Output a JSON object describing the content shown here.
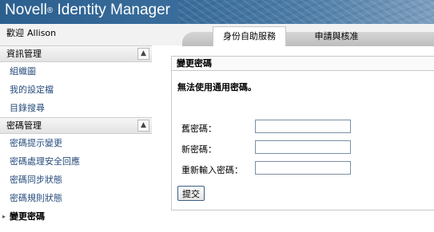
{
  "header": {
    "brand_name": "Novell",
    "brand_mark": "®",
    "product": "Identity Manager"
  },
  "welcome": {
    "label": "歡迎",
    "user": "Allison"
  },
  "tabs": [
    {
      "label": "身份自助服務",
      "active": true
    },
    {
      "label": "申請與核准",
      "active": false
    }
  ],
  "sidebar": {
    "sections": [
      {
        "title": "資訊管理",
        "collapse_icon": "chevron-up-icon",
        "items": [
          {
            "label": "組織圖"
          },
          {
            "label": "我的設定檔"
          },
          {
            "label": "目錄搜尋"
          }
        ]
      },
      {
        "title": "密碼管理",
        "collapse_icon": "chevron-up-icon",
        "items": [
          {
            "label": "密碼提示變更"
          },
          {
            "label": "密碼處理安全回應"
          },
          {
            "label": "密碼同步狀態"
          },
          {
            "label": "密碼規則狀態"
          },
          {
            "label": "變更密碼",
            "current": true
          }
        ]
      }
    ]
  },
  "panel": {
    "title": "變更密碼",
    "error": "無法使用通用密碼。",
    "fields": {
      "old_password": {
        "label": "舊密碼：",
        "value": ""
      },
      "new_password": {
        "label": "新密碼：",
        "value": ""
      },
      "confirm_password": {
        "label": "重新輸入密碼：",
        "value": ""
      }
    },
    "submit_label": "提交"
  },
  "colors": {
    "header_blue": "#2b5f8e",
    "link_blue": "#274d7e"
  }
}
